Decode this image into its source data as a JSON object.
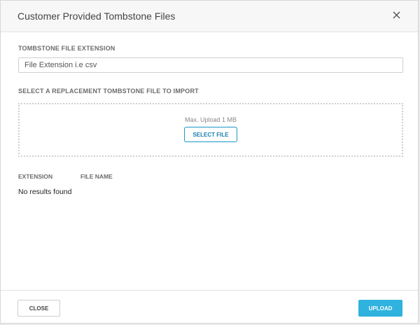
{
  "modal": {
    "title": "Customer Provided Tombstone Files"
  },
  "extension_field": {
    "label": "TOMBSTONE FILE EXTENSION",
    "placeholder": "File Extension i.e csv"
  },
  "import_section": {
    "label": "SELECT A REPLACEMENT TOMBSTONE FILE TO IMPORT",
    "upload_hint": "Max. Upload 1 MB",
    "select_button": "SELECT FILE"
  },
  "files_table": {
    "columns": [
      "EXTENSION",
      "FILE NAME"
    ],
    "empty_message": "No results found"
  },
  "footer": {
    "close_label": "CLOSE",
    "upload_label": "UPLOAD"
  },
  "icons": {
    "close": "close-icon"
  },
  "colors": {
    "primary": "#2fb2de",
    "primary_border": "#1a96c8",
    "header_bg": "#f7f7f7"
  }
}
